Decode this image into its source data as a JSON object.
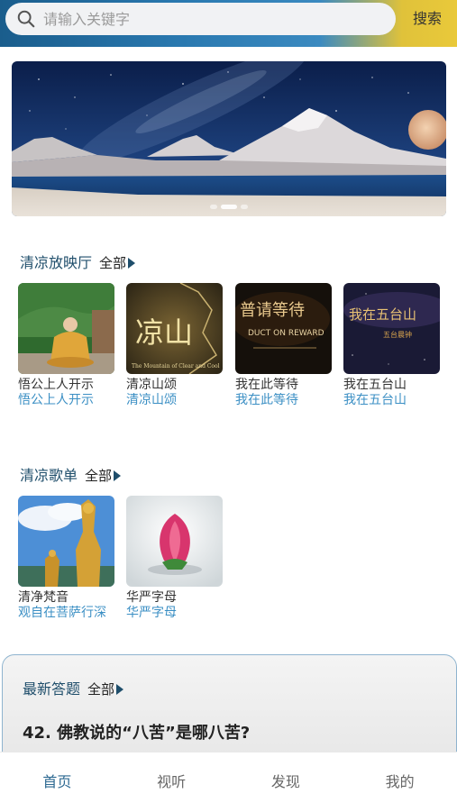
{
  "search": {
    "placeholder": "请输入关键字",
    "button_label": "搜索"
  },
  "banner": {
    "slide_count": 3,
    "active_index": 1
  },
  "cinema": {
    "title": "清凉放映厅",
    "more_label": "全部",
    "items": [
      {
        "name": "悟公上人开示",
        "sub": "悟公上人开示"
      },
      {
        "name": "清凉山颂",
        "sub": "清凉山颂",
        "overlay": "凉山",
        "caption": "The Mountain of Clear and Cool"
      },
      {
        "name": "我在此等待",
        "sub": "我在此等待",
        "overlay": "普请等待",
        "caption": "DUCT ON REWARD"
      },
      {
        "name": "我在五台山",
        "sub": "我在五台山",
        "overlay": "我在五台山",
        "caption": "五台晨钟"
      }
    ]
  },
  "songs": {
    "title": "清凉歌单",
    "more_label": "全部",
    "items": [
      {
        "name": "清净梵音",
        "sub": "观自在菩萨行深"
      },
      {
        "name": "华严字母",
        "sub": "华严字母"
      }
    ]
  },
  "qa": {
    "title": "最新答题",
    "more_label": "全部",
    "question": "42. 佛教说的“八苦”是哪八苦?"
  },
  "tabs": [
    {
      "label": "首页",
      "active": true
    },
    {
      "label": "视听",
      "active": false
    },
    {
      "label": "发现",
      "active": false
    },
    {
      "label": "我的",
      "active": false
    }
  ],
  "colors": {
    "accent": "#2e6a92",
    "subtitle": "#3b8fc4",
    "section_title": "#1f4e6b"
  }
}
